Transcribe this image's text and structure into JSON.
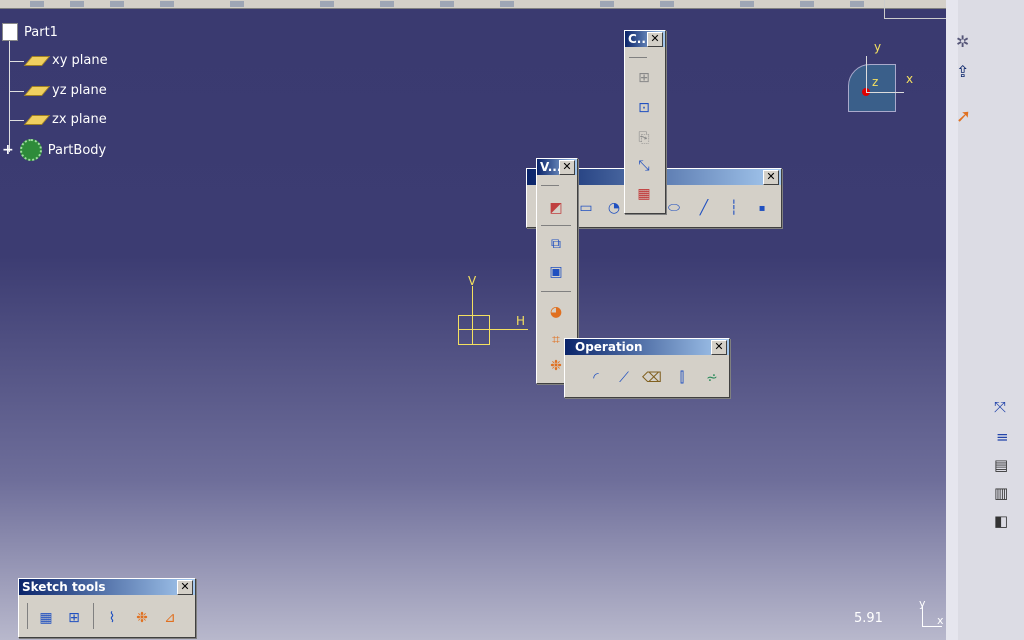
{
  "tree": {
    "root": "Part1",
    "items": [
      {
        "label": "xy plane"
      },
      {
        "label": "yz plane"
      },
      {
        "label": "zx plane"
      },
      {
        "label": "PartBody"
      }
    ]
  },
  "toolbars": {
    "constraint": {
      "title": "C..."
    },
    "visualization": {
      "title": "V..."
    },
    "profile": {
      "title": ""
    },
    "operation": {
      "title": "Operation"
    },
    "sketch_tools": {
      "title": "Sketch tools"
    }
  },
  "compass": {
    "x": "x",
    "y": "y",
    "z": "z"
  },
  "sketch_axes": {
    "v": "V",
    "h": "H"
  },
  "status": {
    "zoom": "5.91",
    "corner_y": "y",
    "corner_x": "x"
  },
  "colors": {
    "accent": "#0a246a",
    "axis": "#f4e060"
  }
}
